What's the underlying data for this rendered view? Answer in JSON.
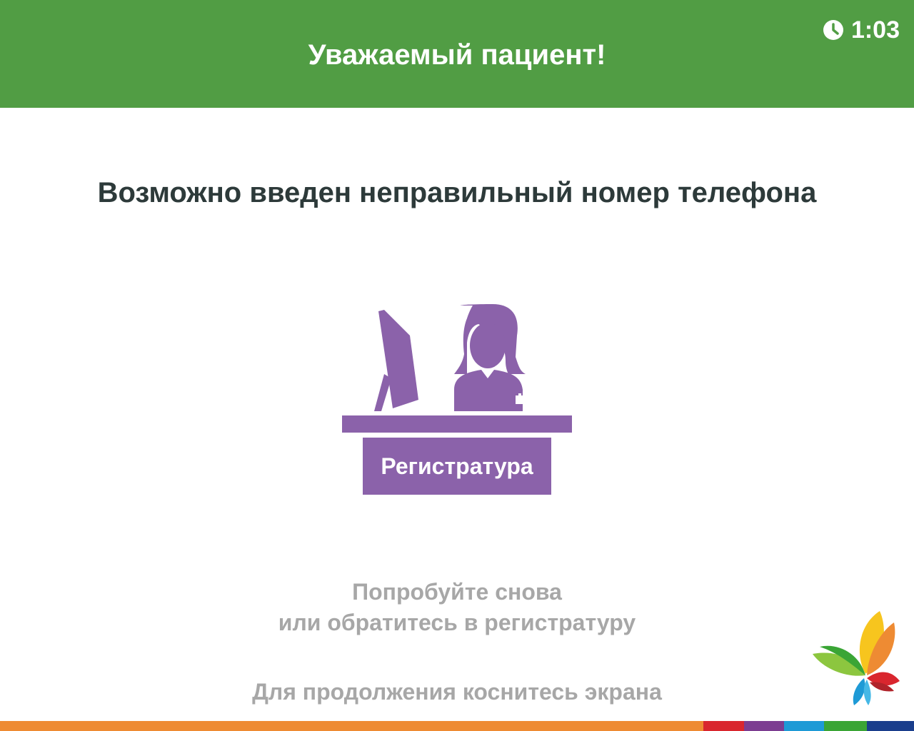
{
  "header": {
    "title": "Уважаемый пациент!",
    "timer": "1:03",
    "timer_icon": "clock-icon"
  },
  "message": "Возможно введен неправильный номер телефона",
  "illustration": {
    "icon": "receptionist-desk-icon",
    "desk_label": "Регистратура"
  },
  "hint": {
    "line1": "Попробуйте снова",
    "line2": "или обратитесь в регистратуру"
  },
  "continue_text": "Для продолжения коснитесь экрана",
  "logo": {
    "icon": "butterfly-logo-icon"
  },
  "colors": {
    "header_bg": "#519d44",
    "accent_purple": "#8b62aa",
    "text_dark": "#2d3a3a",
    "text_gray": "#a7a7a7",
    "stripe": [
      "#ee8b33",
      "#d9262e",
      "#7c3d91",
      "#1e9ad6",
      "#3aa535",
      "#1a3e8c"
    ]
  }
}
